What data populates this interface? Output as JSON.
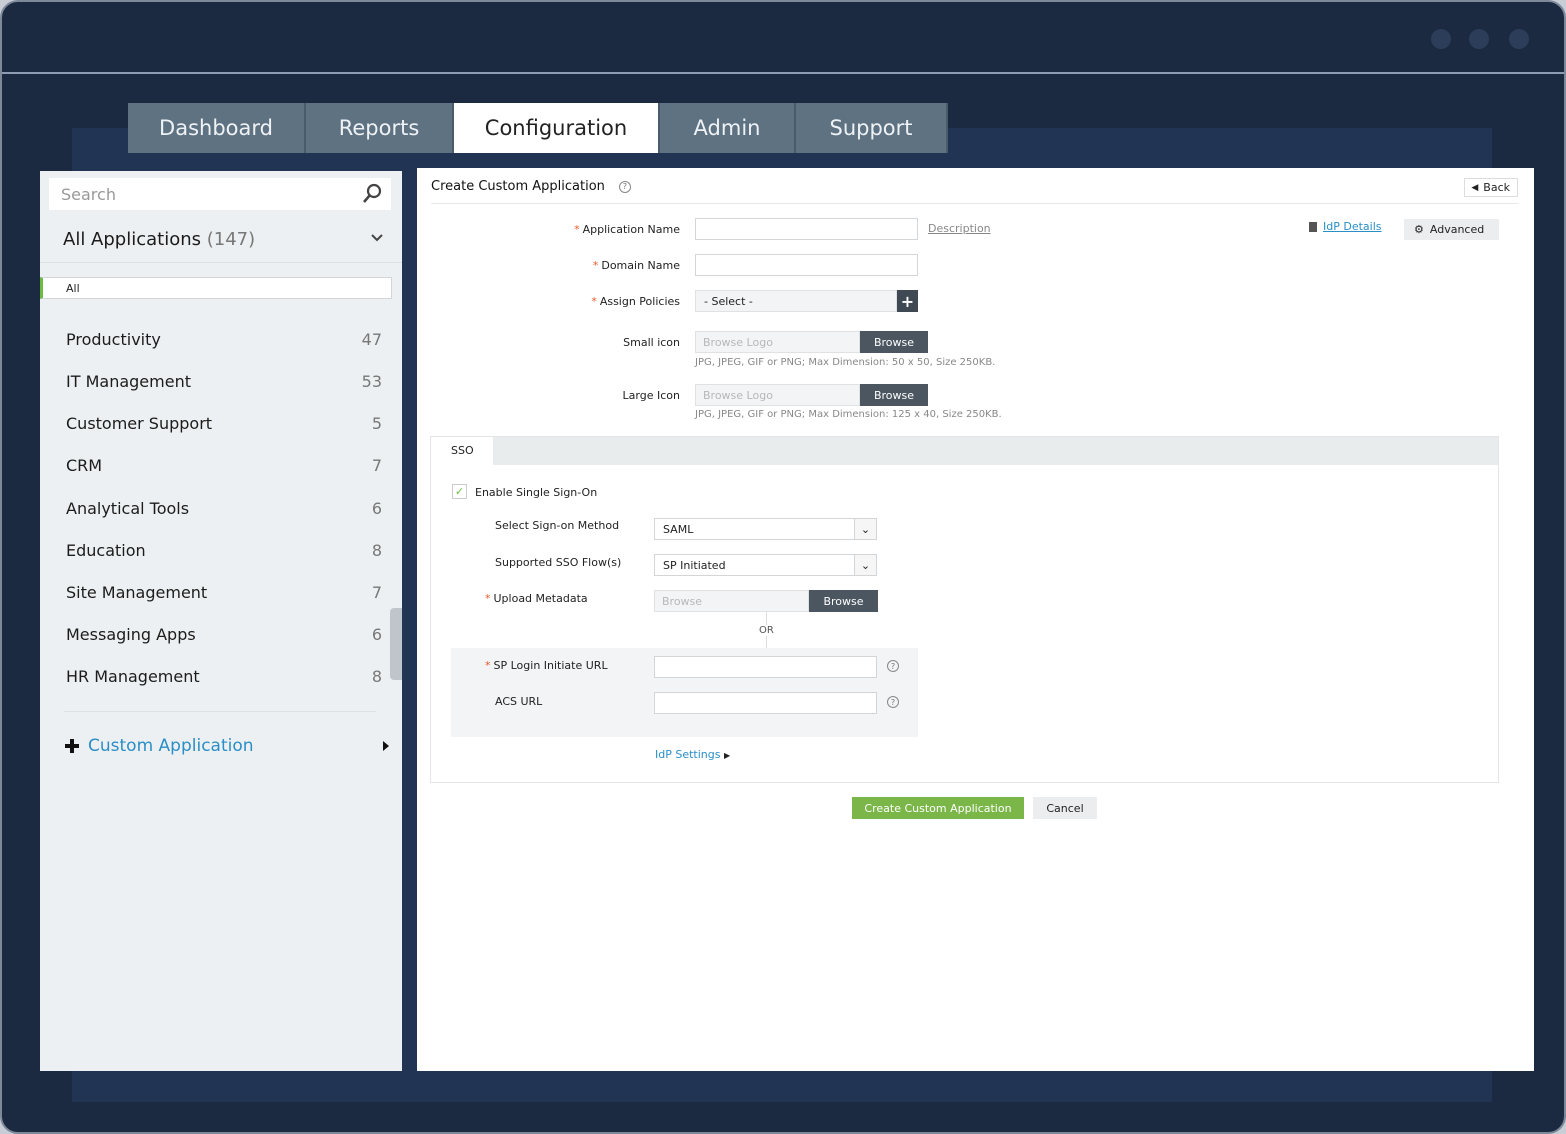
{
  "nav": {
    "tabs": [
      {
        "label": "Dashboard"
      },
      {
        "label": "Reports"
      },
      {
        "label": "Configuration",
        "active": true
      },
      {
        "label": "Admin"
      },
      {
        "label": "Support"
      }
    ]
  },
  "sidebar": {
    "search_placeholder": "Search",
    "header": {
      "label": "All Applications",
      "count": "(147)"
    },
    "items": [
      {
        "label": "All",
        "count": ""
      },
      {
        "label": "Productivity",
        "count": "47"
      },
      {
        "label": "IT Management",
        "count": "53"
      },
      {
        "label": "Customer Support",
        "count": "5"
      },
      {
        "label": "CRM",
        "count": "7"
      },
      {
        "label": "Analytical Tools",
        "count": "6"
      },
      {
        "label": "Education",
        "count": "8"
      },
      {
        "label": "Site Management",
        "count": "7"
      },
      {
        "label": "Messaging Apps",
        "count": "6"
      },
      {
        "label": "HR Management",
        "count": "8"
      }
    ],
    "custom_app": "Custom Application"
  },
  "form": {
    "title": "Create Custom Application",
    "back": "Back",
    "idp_details": "IdP Details",
    "advanced": "Advanced",
    "application_name": {
      "label": "Application Name",
      "value": ""
    },
    "description_link": "Description",
    "domain_name": {
      "label": "Domain Name",
      "value": ""
    },
    "assign_policies": {
      "label": "Assign Policies",
      "value": "- Select -"
    },
    "small_icon": {
      "label": "Small icon",
      "placeholder": "Browse Logo",
      "button": "Browse",
      "hint": "JPG, JPEG, GIF or PNG; Max Dimension: 50 x 50, Size 250KB."
    },
    "large_icon": {
      "label": "Large Icon",
      "placeholder": "Browse Logo",
      "button": "Browse",
      "hint": "JPG, JPEG, GIF or PNG; Max Dimension: 125 x 40, Size 250KB."
    },
    "sso": {
      "tab": "SSO",
      "enable_label": "Enable Single Sign-On",
      "enabled": true,
      "method": {
        "label": "Select Sign-on Method",
        "value": "SAML"
      },
      "flows": {
        "label": "Supported SSO Flow(s)",
        "value": "SP Initiated"
      },
      "metadata": {
        "label": "Upload Metadata",
        "placeholder": "Browse",
        "button": "Browse"
      },
      "or": "OR",
      "sp_login_url": {
        "label": "SP Login Initiate URL",
        "value": ""
      },
      "acs_url": {
        "label": "ACS URL",
        "value": ""
      },
      "idp_settings": "IdP Settings"
    },
    "create_button": "Create Custom Application",
    "cancel_button": "Cancel"
  },
  "colors": {
    "accent_green": "#7ab648",
    "link_blue": "#2a8ec7",
    "tab_gray": "#5f7282",
    "frame": "#1b2a40"
  }
}
